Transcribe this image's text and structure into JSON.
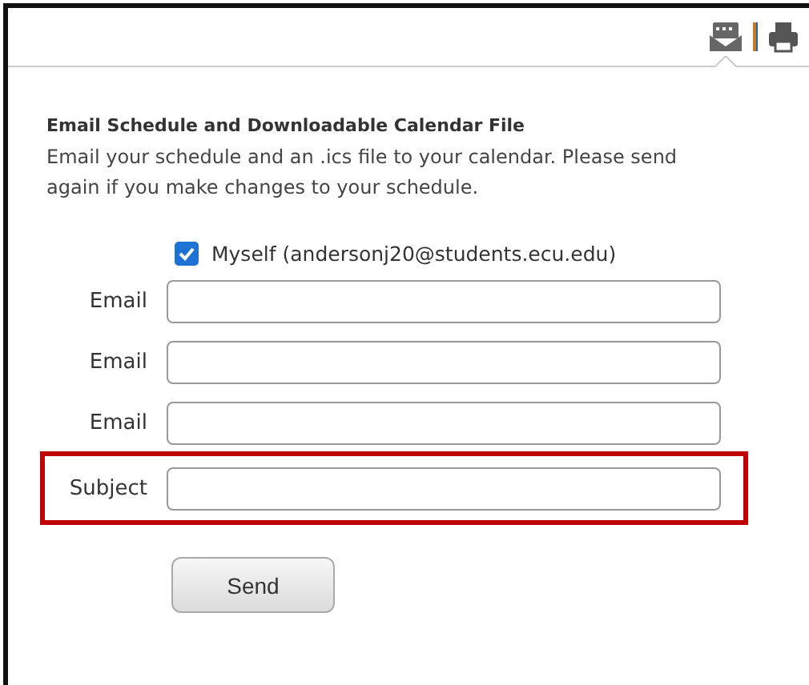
{
  "toolbar": [
    {
      "kind": "email",
      "selected": true
    },
    {
      "kind": "print",
      "selected": false
    }
  ],
  "title": "Email Schedule and Downloadable Calendar File",
  "description": "Email your schedule and an .ics file to your calendar. Please send again if you make changes to your schedule.",
  "myself": {
    "label": "Myself (andersonj20@students.ecu.edu)",
    "checked": true
  },
  "fields": [
    {
      "label": "Email",
      "highlighted": false
    },
    {
      "label": "Email",
      "highlighted": false
    },
    {
      "label": "Email",
      "highlighted": false
    },
    {
      "label": "Subject",
      "highlighted": true
    }
  ],
  "send_button": "Send"
}
